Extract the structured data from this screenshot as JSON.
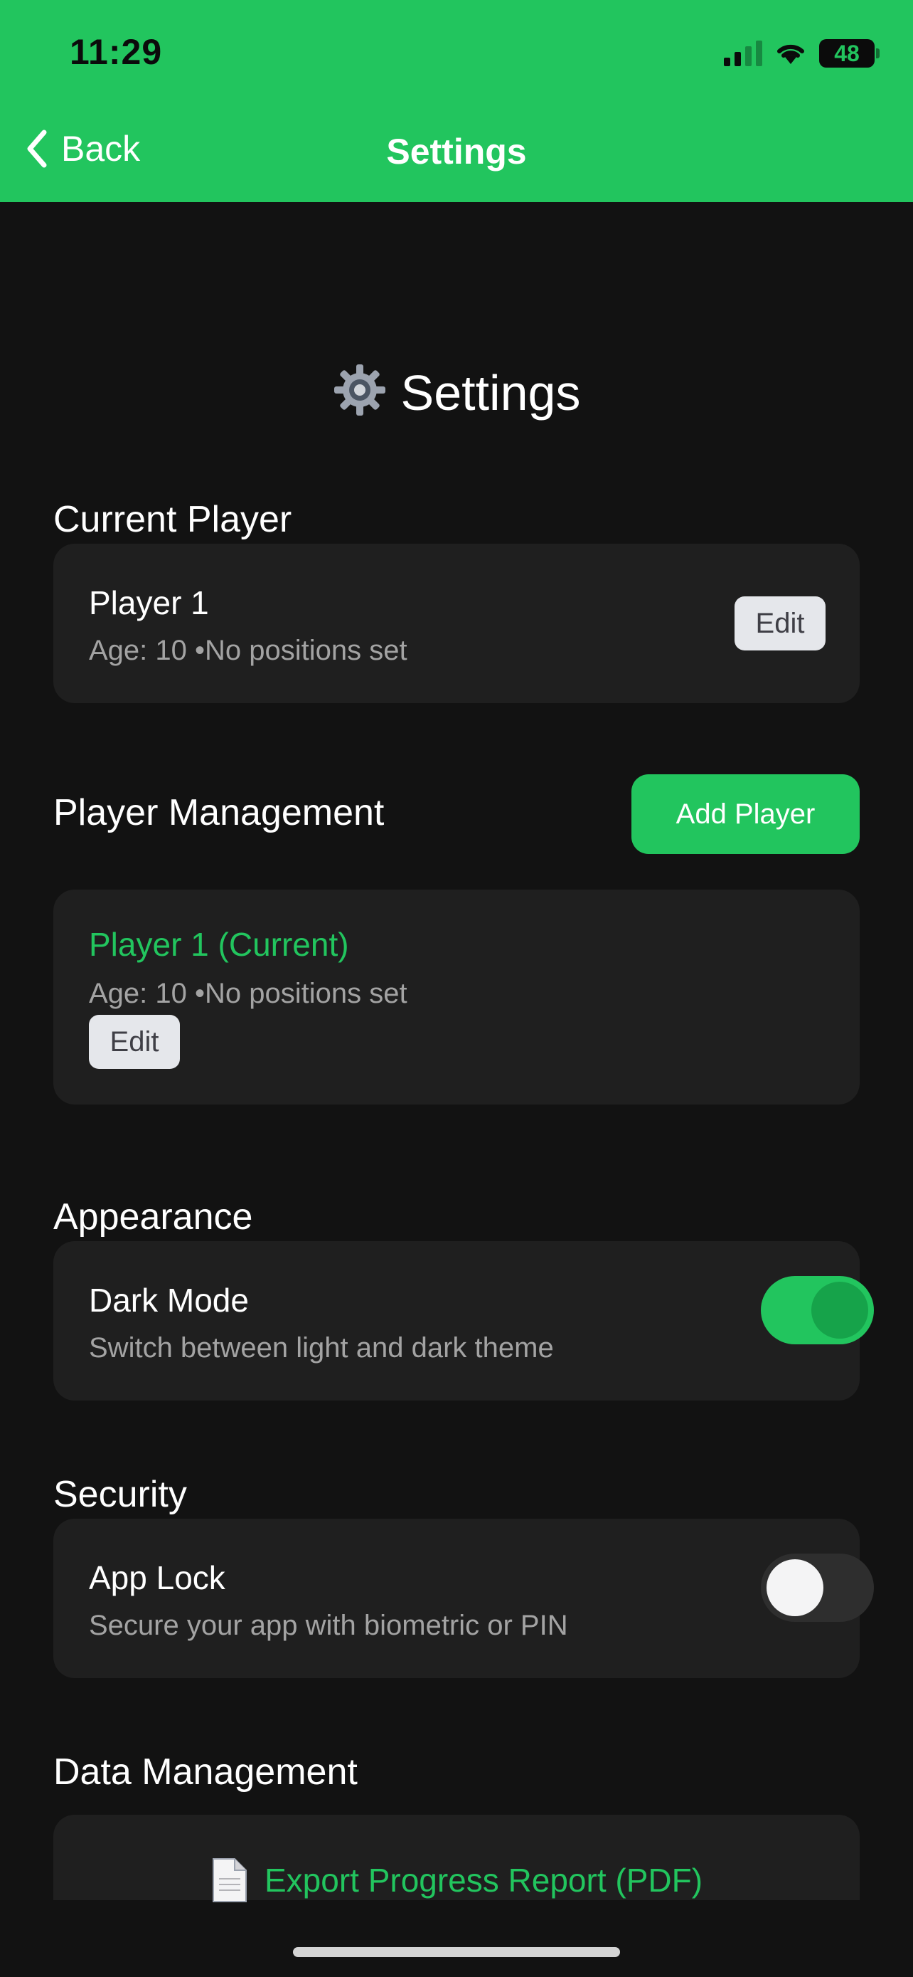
{
  "status_bar": {
    "time": "11:29",
    "battery": "48"
  },
  "nav": {
    "back_label": "Back",
    "title": "Settings"
  },
  "page": {
    "heading": "Settings"
  },
  "current_player": {
    "section_title": "Current Player",
    "name": "Player 1",
    "details": "Age: 10 •No positions set",
    "edit_label": "Edit"
  },
  "player_management": {
    "section_title": "Player Management",
    "add_label": "Add Player",
    "players": [
      {
        "name": "Player 1 (Current)",
        "details": "Age: 10 •No positions set",
        "edit_label": "Edit"
      }
    ]
  },
  "appearance": {
    "section_title": "Appearance",
    "dark_mode": {
      "label": "Dark Mode",
      "description": "Switch between light and dark theme",
      "enabled": true
    }
  },
  "security": {
    "section_title": "Security",
    "app_lock": {
      "label": "App Lock",
      "description": "Secure your app with biometric or PIN",
      "enabled": false
    }
  },
  "data_management": {
    "section_title": "Data Management",
    "export_label": "Export Progress Report (PDF)"
  },
  "colors": {
    "accent": "#22c55e",
    "background": "#121212",
    "card": "#1f1f1f"
  }
}
